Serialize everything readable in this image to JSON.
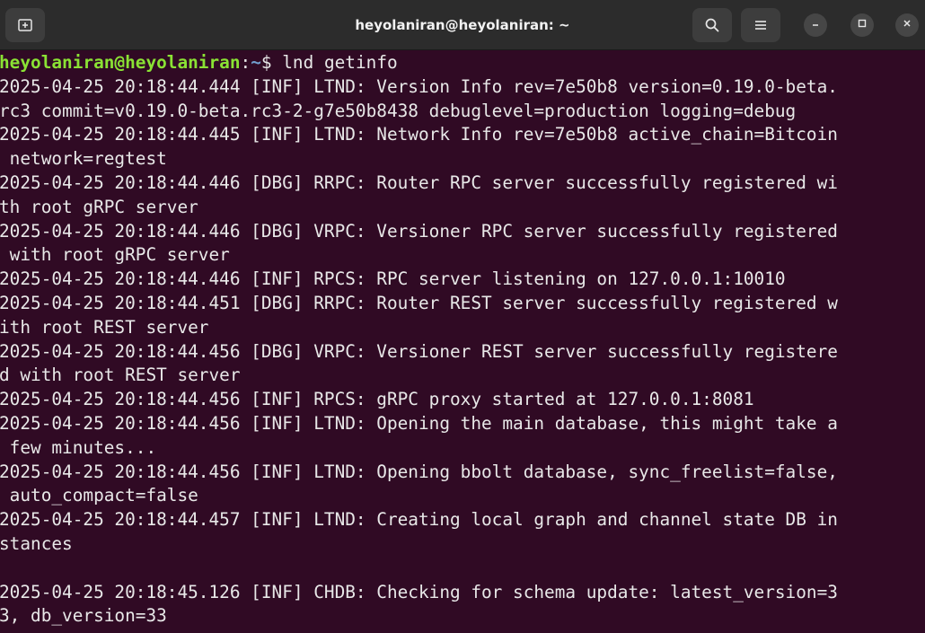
{
  "window": {
    "title": "heyolaniran@heyolaniran: ~",
    "icons": {
      "new_tab": "new-tab-icon",
      "search": "search-icon",
      "menu": "hamburger-menu-icon",
      "minimize": "minimize-icon",
      "maximize": "maximize-icon",
      "close": "close-icon"
    }
  },
  "terminal": {
    "prompt": {
      "user_host": "heyolaniran@heyolaniran",
      "sep": ":",
      "path": "~",
      "symbol": "$ ",
      "command": "lnd getinfo"
    },
    "lines": [
      "2025-04-25 20:18:44.444 [INF] LTND: Version Info rev=7e50b8 version=0.19.0-beta.",
      "rc3 commit=v0.19.0-beta.rc3-2-g7e50b8438 debuglevel=production logging=debug",
      "2025-04-25 20:18:44.445 [INF] LTND: Network Info rev=7e50b8 active_chain=Bitcoin",
      " network=regtest",
      "2025-04-25 20:18:44.446 [DBG] RRPC: Router RPC server successfully registered wi",
      "th root gRPC server",
      "2025-04-25 20:18:44.446 [DBG] VRPC: Versioner RPC server successfully registered",
      " with root gRPC server",
      "2025-04-25 20:18:44.446 [INF] RPCS: RPC server listening on 127.0.0.1:10010",
      "2025-04-25 20:18:44.451 [DBG] RRPC: Router REST server successfully registered w",
      "ith root REST server",
      "2025-04-25 20:18:44.456 [DBG] VRPC: Versioner REST server successfully registere",
      "d with root REST server",
      "2025-04-25 20:18:44.456 [INF] RPCS: gRPC proxy started at 127.0.0.1:8081",
      "2025-04-25 20:18:44.456 [INF] LTND: Opening the main database, this might take a",
      " few minutes...",
      "2025-04-25 20:18:44.456 [INF] LTND: Opening bbolt database, sync_freelist=false,",
      " auto_compact=false",
      "2025-04-25 20:18:44.457 [INF] LTND: Creating local graph and channel state DB in",
      "stances",
      "",
      "2025-04-25 20:18:45.126 [INF] CHDB: Checking for schema update: latest_version=3",
      "3, db_version=33"
    ]
  },
  "colors": {
    "terminal_bg": "#300a24",
    "titlebar_bg": "#2c2c2c",
    "text": "#e8e8e8",
    "prompt_user": "#8ae234",
    "prompt_path": "#729fcf"
  }
}
